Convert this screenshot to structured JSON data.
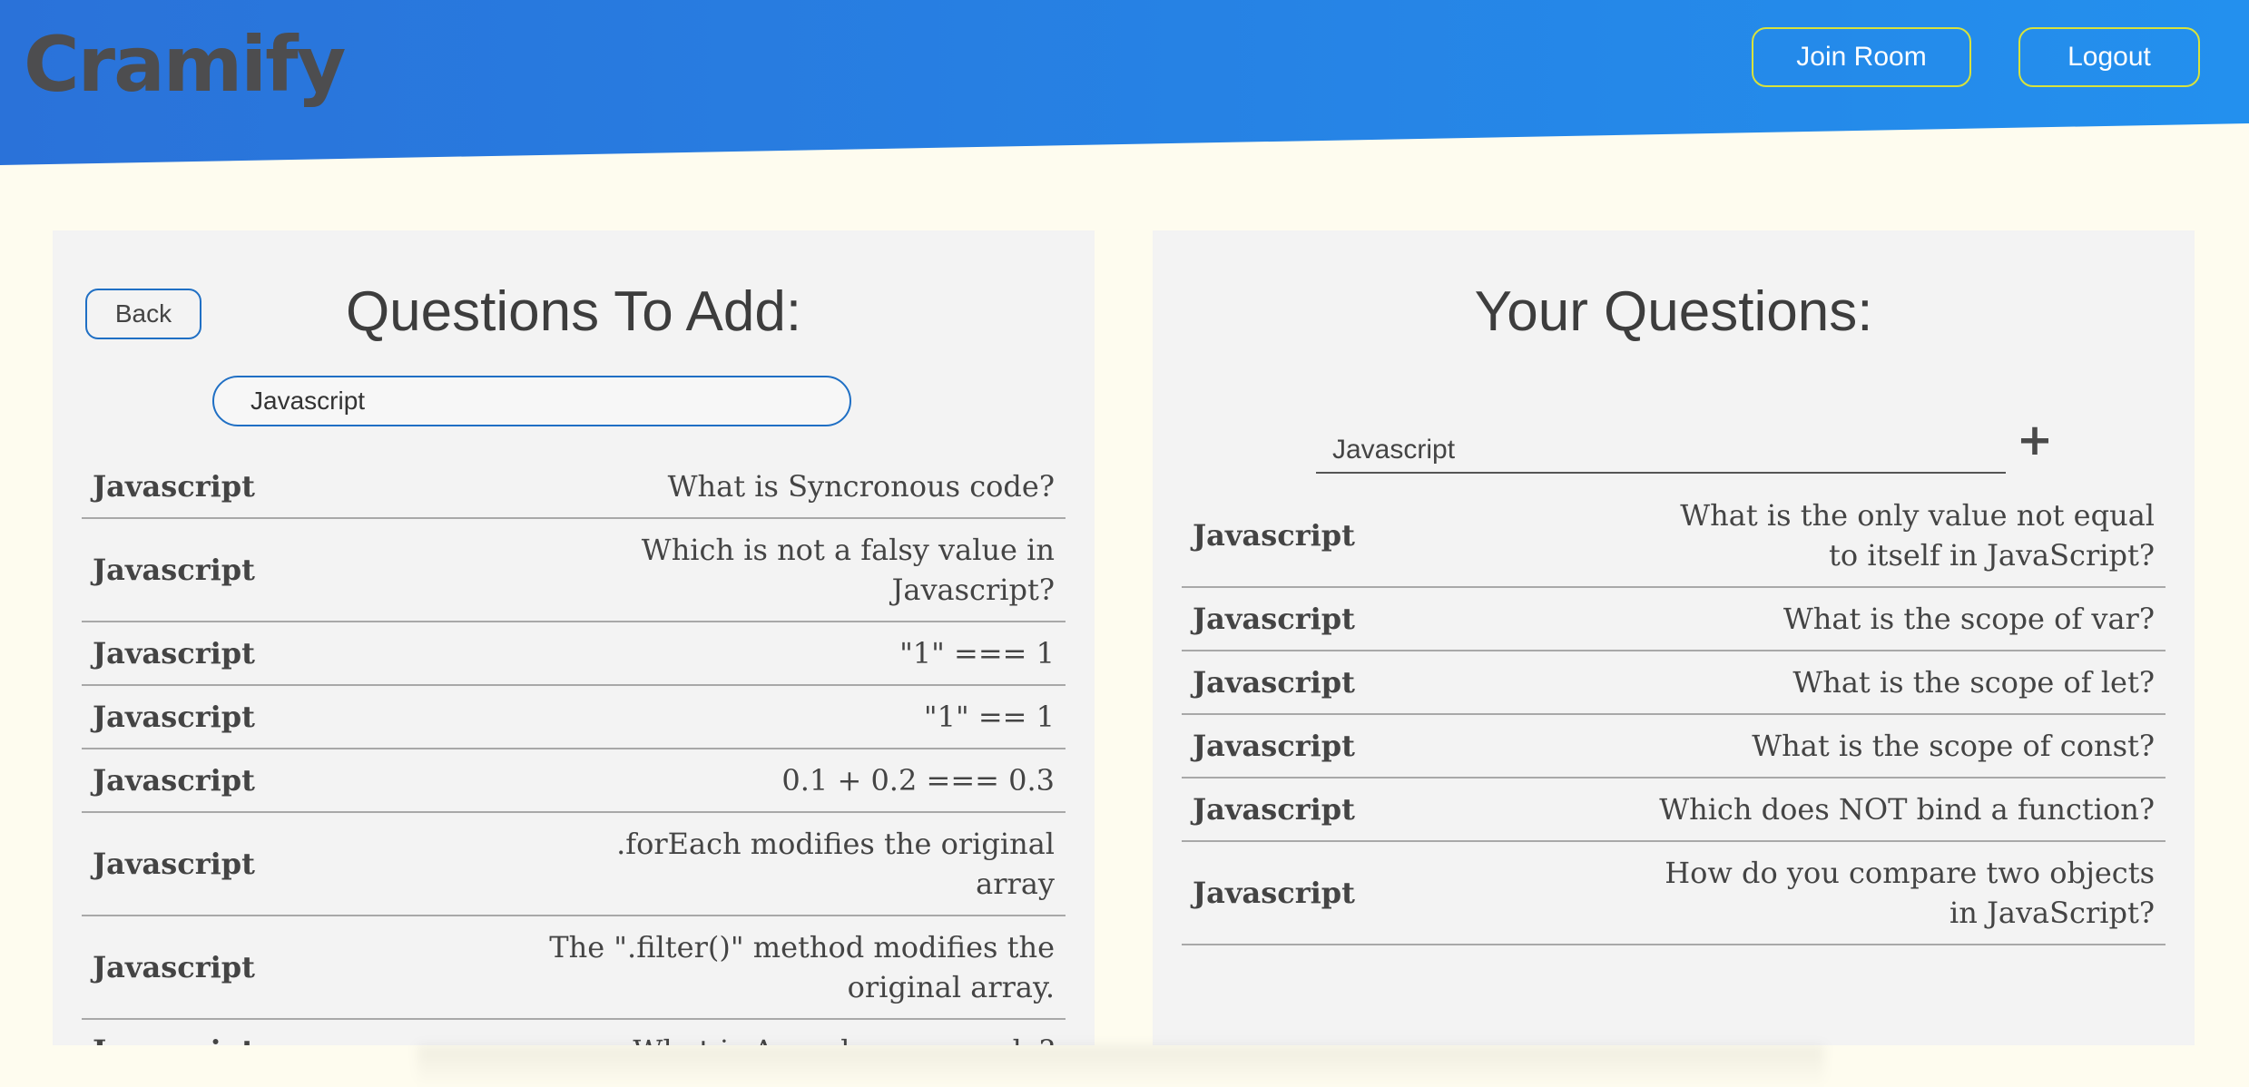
{
  "header": {
    "logo": "Cramify",
    "join_room_label": "Join Room",
    "logout_label": "Logout"
  },
  "left_panel": {
    "back_label": "Back",
    "title": "Questions To Add:",
    "search_value": "Javascript",
    "questions": [
      {
        "category": "Javascript",
        "text": "What is Syncronous code?"
      },
      {
        "category": "Javascript",
        "text": "Which is not a falsy value in Javascript?"
      },
      {
        "category": "Javascript",
        "text": "\"1\" === 1"
      },
      {
        "category": "Javascript",
        "text": "\"1\" == 1"
      },
      {
        "category": "Javascript",
        "text": "0.1 + 0.2 === 0.3"
      },
      {
        "category": "Javascript",
        "text": ".forEach modifies the original array"
      },
      {
        "category": "Javascript",
        "text": "The \".filter()\" method modifies the original array."
      },
      {
        "category": "Javascript",
        "text": "What is Asynchronous code?"
      }
    ]
  },
  "right_panel": {
    "title": "Your Questions:",
    "category_value": "Javascript",
    "add_icon": "plus-icon",
    "questions": [
      {
        "category": "Javascript",
        "text": "What is the only value not equal to itself in JavaScript?"
      },
      {
        "category": "Javascript",
        "text": "What is the scope of var?"
      },
      {
        "category": "Javascript",
        "text": "What is the scope of let?"
      },
      {
        "category": "Javascript",
        "text": "What is the scope of const?"
      },
      {
        "category": "Javascript",
        "text": "Which does NOT bind a function?"
      },
      {
        "category": "Javascript",
        "text": "How do you compare two objects in JavaScript?"
      }
    ]
  },
  "colors": {
    "header_start": "#2a72d9",
    "header_end": "#2390ee",
    "button_border": "#d8e23c",
    "accent_blue": "#1f6fc4",
    "page_bg": "#fefcef",
    "panel_bg": "#f3f3f3"
  }
}
